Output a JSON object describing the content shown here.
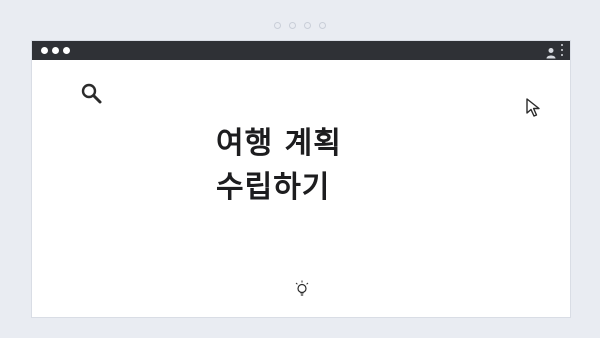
{
  "carousel": {
    "dot_count": 4
  },
  "browser": {
    "titlebar_color": "#2f3136",
    "page_background": "#ffffff"
  },
  "icons": {
    "search": "search-icon",
    "cursor": "cursor-icon",
    "profile": "profile-icon",
    "menu": "kebab-menu-icon",
    "idea": "lightbulb-icon"
  },
  "headline": {
    "line1": "여행 계획",
    "line2": "수립하기"
  }
}
